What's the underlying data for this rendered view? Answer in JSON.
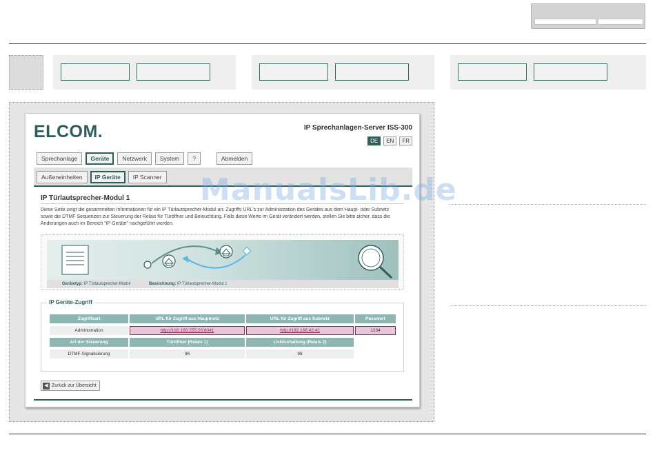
{
  "app": {
    "logo": "ELCOM.",
    "server_title": "IP Sprechanlagen-Server ISS-300",
    "languages": [
      "DE",
      "EN",
      "FR"
    ]
  },
  "main_tabs": [
    {
      "label": "Sprechanlage",
      "active": false
    },
    {
      "label": "Geräte",
      "active": true
    },
    {
      "label": "Netzwerk",
      "active": false
    },
    {
      "label": "System",
      "active": false
    },
    {
      "label": "?",
      "active": false
    }
  ],
  "logout_label": "Abmelden",
  "sub_tabs": [
    {
      "label": "Außeneinheiten",
      "active": false
    },
    {
      "label": "IP Geräte",
      "active": true
    },
    {
      "label": "IP Scanner",
      "active": false
    }
  ],
  "content": {
    "title": "IP Türlautsprecher-Modul 1",
    "description": "Diese Seite zeigt die gesammelten Informationen für ein IP Türlautsprecher-Modul an: Zugriffs URL's zur Administration des Gerätes aus dem Haupt- oder Subnetz sowie die DTMF Sequenzen zur Steuerung der Relais für Türöffner und Beleuchtung. Falls diese Werte im Gerät verändert werden, stellen Sie bitte sicher, dass die Änderungen auch im Bereich \"IP Geräte\" nachgeführt werden.",
    "caption_type_label": "Gerätetyp:",
    "caption_type_value": "IP Türlautsprecher-Modul",
    "caption_name_label": "Bezeichnung:",
    "caption_name_value": "IP Türlautsprecher-Modul 1"
  },
  "access": {
    "legend": "IP Geräte-Zugriff",
    "headers": [
      "Zugriffsart",
      "URL für Zugriff aus Hauptnetz",
      "URL für Zugriff aus Subnetz",
      "Passwort"
    ],
    "row": [
      "Administration",
      "http://192.168.255.26:8041",
      "http://192.168.42.41",
      "1234"
    ],
    "control_headers": [
      "Art der Steuerung",
      "Türöffner (Relais 1)",
      "Lichtschaltung (Relais 2)"
    ],
    "control_row": [
      "DTMF-Signalisierung",
      "96",
      "98"
    ]
  },
  "back_label": "Zurück zur Übersicht",
  "watermark": "ManualsLib.de",
  "colors": {
    "accent": "#2e5e5a",
    "header_cell": "#8fb6b2",
    "highlight_border": "#8e2c56",
    "highlight_fill": "#e8c8d8"
  }
}
